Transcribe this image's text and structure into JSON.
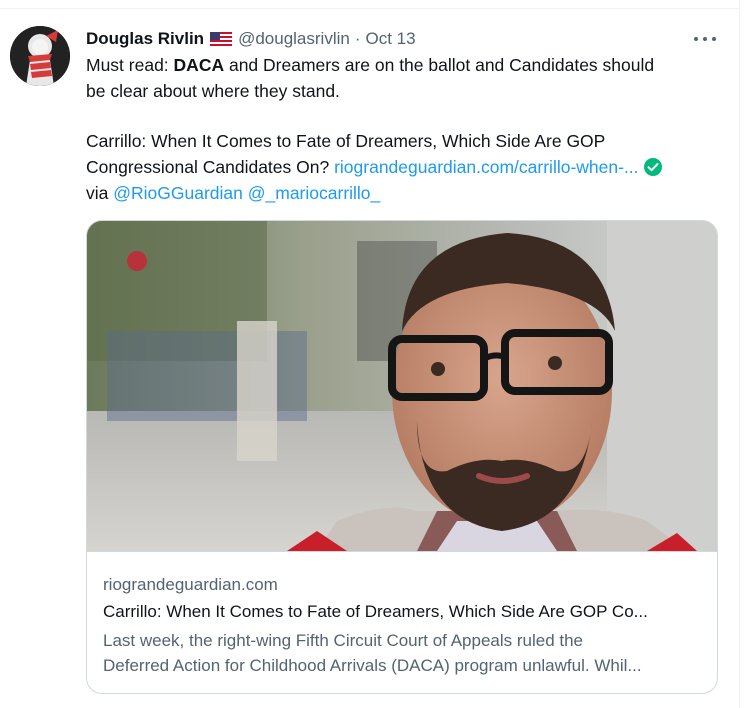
{
  "tweet": {
    "author_name": "Douglas Rivlin",
    "flag_icon": "us-flag-icon",
    "handle": "@douglasrivlin",
    "separator": "·",
    "date": "Oct 13",
    "more_icon": "more-options-icon",
    "line1_a": "Must read: ",
    "line1_b": "DACA",
    "line1_c": " and Dreamers are on the ballot and Candidates should",
    "line2": "be clear about where they stand.",
    "line3": "Carrillo: When It Comes to Fate of Dreamers, Which Side Are GOP",
    "line4_a": "Congressional Candidates On? ",
    "line4_link": "riograndeguardian.com/carrillo-when-...",
    "line5_via": "via ",
    "mention1": "@RioGGuardian",
    "mention2": "@_mariocarrillo_"
  },
  "card": {
    "domain": "riograndeguardian.com",
    "title": "Carrillo: When It Comes to Fate of Dreamers, Which Side Are GOP Co...",
    "desc_line1": "Last week, the right-wing Fifth Circuit Court of Appeals ruled the",
    "desc_line2": "Deferred Action for Childhood Arrivals (DACA) program unlawful. Whil..."
  },
  "colors": {
    "link": "#1d9bf0",
    "secondary_text": "#536471",
    "verified": "#00ba7c"
  }
}
